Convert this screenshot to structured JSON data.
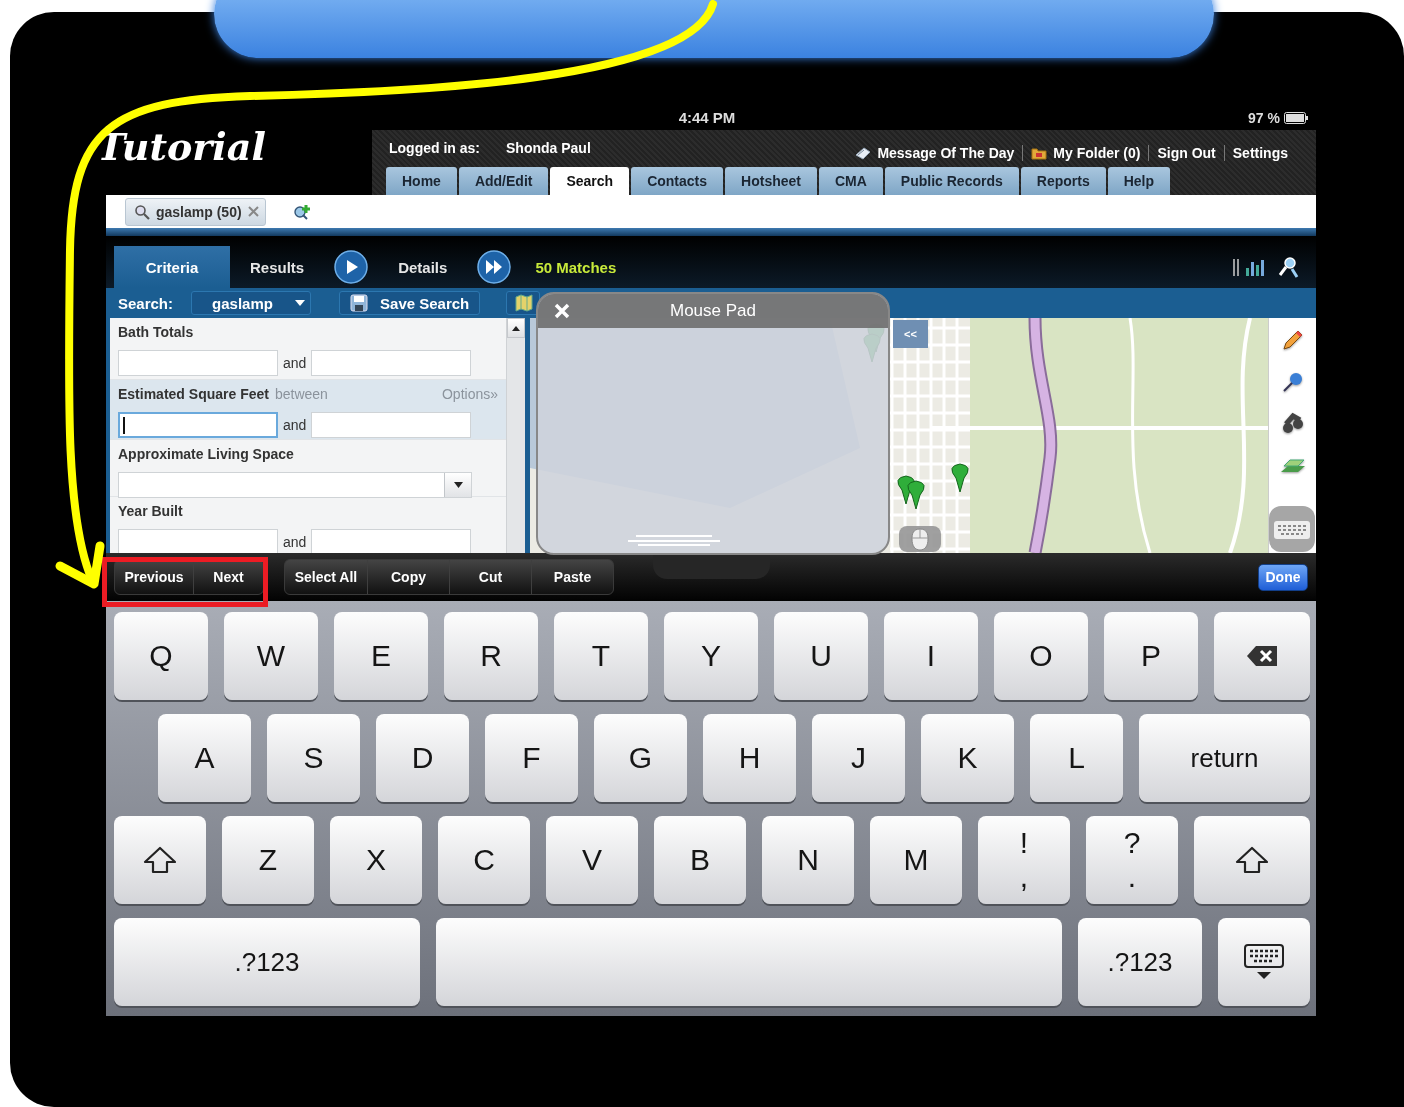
{
  "tutorial_title": "Tutorial",
  "status_bar": {
    "time": "4:44 PM",
    "battery": "97 %"
  },
  "header": {
    "logged_in_label": "Logged in as:",
    "user": "Shonda Paul",
    "links": [
      {
        "label": "Message Of The Day",
        "kind": "note"
      },
      {
        "label": "My Folder (0)",
        "kind": "folder"
      },
      {
        "label": "Sign Out",
        "kind": "plain"
      },
      {
        "label": "Settings",
        "kind": "plain"
      }
    ]
  },
  "nav_tabs": [
    {
      "label": "Home",
      "selected": false
    },
    {
      "label": "Add/Edit",
      "selected": false
    },
    {
      "label": "Search",
      "selected": true
    },
    {
      "label": "Contacts",
      "selected": false
    },
    {
      "label": "Hotsheet",
      "selected": false
    },
    {
      "label": "CMA",
      "selected": false
    },
    {
      "label": "Public Records",
      "selected": false
    },
    {
      "label": "Reports",
      "selected": false
    },
    {
      "label": "Help",
      "selected": false
    }
  ],
  "search_tabs": [
    {
      "label": "gaslamp (50)"
    }
  ],
  "view_tabs": [
    {
      "label": "Criteria",
      "selected": true
    },
    {
      "label": "Results",
      "selected": false
    },
    {
      "label": "Details",
      "selected": false
    }
  ],
  "matches": "50 Matches",
  "search_bar": {
    "label": "Search:",
    "value": "gaslamp",
    "save": "Save Search"
  },
  "criteria": [
    {
      "label": "Bath Totals",
      "kind": "range",
      "connector": "and",
      "focused": false
    },
    {
      "label": "Estimated Square Feet",
      "hint": "between",
      "options": "Options»",
      "kind": "range",
      "connector": "and",
      "focused": true
    },
    {
      "label": "Approximate Living Space",
      "kind": "select",
      "focused": false
    },
    {
      "label": "Year Built",
      "kind": "range",
      "connector": "and",
      "focused": false
    }
  ],
  "map": {
    "collapse": "<<"
  },
  "mouse_pad": {
    "title": "Mouse Pad"
  },
  "edit_toolbar": {
    "nav": [
      "Previous",
      "Next"
    ],
    "actions": [
      "Select All",
      "Copy",
      "Cut",
      "Paste"
    ],
    "done": "Done"
  },
  "keyboard": {
    "key_rows": [
      {
        "keys": [
          {
            "kind": "letter",
            "label": "Q"
          },
          {
            "kind": "letter",
            "label": "W"
          },
          {
            "kind": "letter",
            "label": "E"
          },
          {
            "kind": "letter",
            "label": "R"
          },
          {
            "kind": "letter",
            "label": "T"
          },
          {
            "kind": "letter",
            "label": "Y"
          },
          {
            "kind": "letter",
            "label": "U"
          },
          {
            "kind": "letter",
            "label": "I"
          },
          {
            "kind": "letter",
            "label": "O"
          },
          {
            "kind": "letter",
            "label": "P"
          },
          {
            "kind": "backspace"
          }
        ]
      },
      {
        "keys": [
          {
            "kind": "letter",
            "label": "A"
          },
          {
            "kind": "letter",
            "label": "S"
          },
          {
            "kind": "letter",
            "label": "D"
          },
          {
            "kind": "letter",
            "label": "F"
          },
          {
            "kind": "letter",
            "label": "G"
          },
          {
            "kind": "letter",
            "label": "H"
          },
          {
            "kind": "letter",
            "label": "J"
          },
          {
            "kind": "letter",
            "label": "K"
          },
          {
            "kind": "letter",
            "label": "L"
          },
          {
            "kind": "return",
            "label": "return"
          }
        ]
      },
      {
        "keys": [
          {
            "kind": "shift"
          },
          {
            "kind": "letter",
            "label": "Z"
          },
          {
            "kind": "letter",
            "label": "X"
          },
          {
            "kind": "letter",
            "label": "C"
          },
          {
            "kind": "letter",
            "label": "V"
          },
          {
            "kind": "letter",
            "label": "B"
          },
          {
            "kind": "letter",
            "label": "N"
          },
          {
            "kind": "letter",
            "label": "M"
          },
          {
            "kind": "dual",
            "top": "!",
            "bottom": ","
          },
          {
            "kind": "dual",
            "top": "?",
            "bottom": "."
          },
          {
            "kind": "shift"
          }
        ]
      },
      {
        "keys": [
          {
            "kind": "mode",
            "label": ".?123"
          },
          {
            "kind": "space"
          },
          {
            "kind": "mode",
            "label": ".?123"
          },
          {
            "kind": "hide"
          }
        ]
      }
    ]
  }
}
